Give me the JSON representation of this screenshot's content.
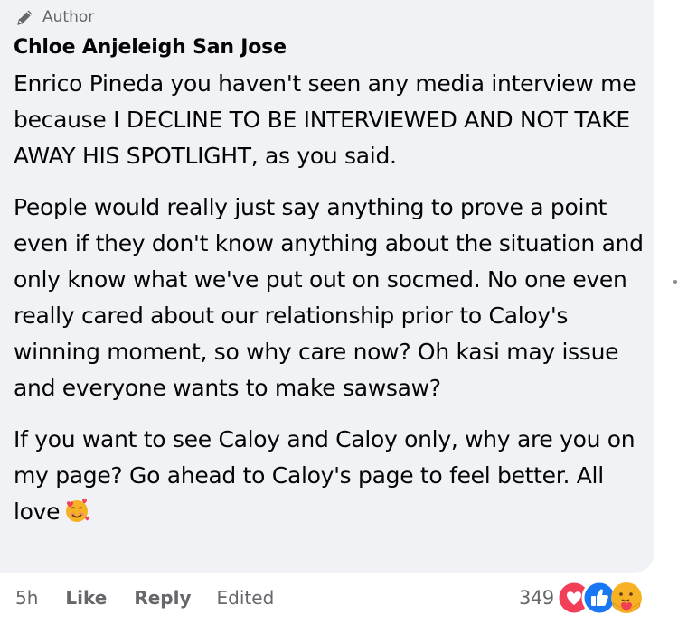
{
  "comment": {
    "author_badge": "Author",
    "author_name": "Chloe Anjeleigh San Jose",
    "paragraphs": [
      "Enrico Pineda you haven't seen any media interview me because I DECLINE TO BE INTERVIEWED AND NOT TAKE AWAY HIS SPOTLIGHT, as you said.",
      "People would really just say anything to prove a point even if they don't know anything about the situation and only know what we've put out on socmed. No one even really cared about our relationship prior to Caloy's winning moment, so why care now? Oh kasi may issue and everyone wants to make sawsaw?",
      "If you want to see Caloy and Caloy only, why are you on my page? Go ahead to Caloy's page to feel better. All love"
    ],
    "end_emoji": "smiling-face-with-hearts-emoji"
  },
  "actions": {
    "time": "5h",
    "like": "Like",
    "reply": "Reply",
    "edited": "Edited"
  },
  "reactions": {
    "count": "349",
    "icons": [
      "love-reaction-icon",
      "like-reaction-icon",
      "care-reaction-icon"
    ]
  },
  "colors": {
    "bubble": "#f0f2f5",
    "secondary_text": "#65676b",
    "like_blue": "#1877f2",
    "love_red": "#f33e58",
    "care_yellow": "#f7b125"
  }
}
